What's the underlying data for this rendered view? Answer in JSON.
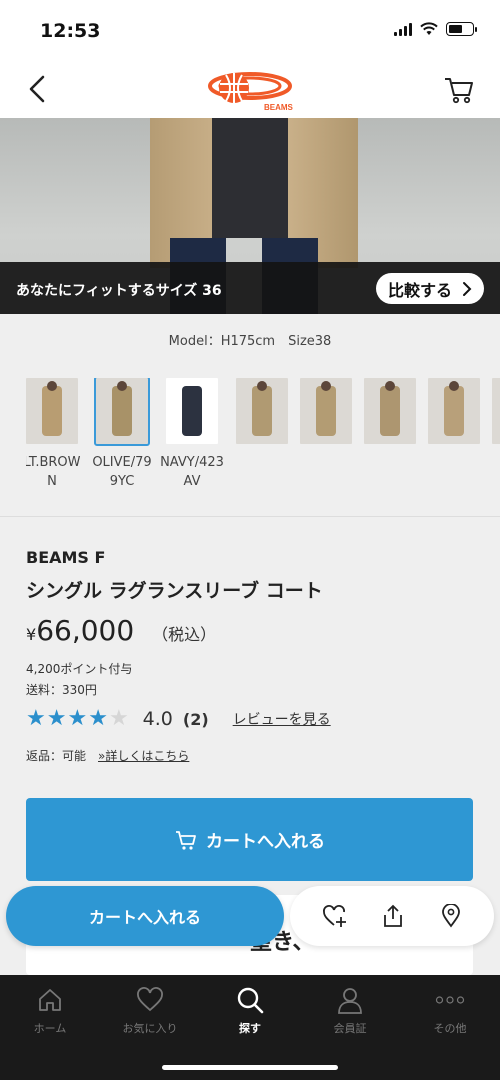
{
  "status_bar": {
    "time": "12:53"
  },
  "header": {
    "logo_text": "BEAMS"
  },
  "hero": {
    "fit_text": "あなたにフィットするサイズ 36",
    "compare_label": "比較する"
  },
  "model_info": "Model：H175cm　Size38",
  "variants": [
    {
      "label": "LT.BROWN",
      "color": "#b89d72",
      "selected": false
    },
    {
      "label": "OLIVE/799YC",
      "color": "#a89268",
      "selected": true
    },
    {
      "label": "NAVY/423AV",
      "color": "#2c3240",
      "selected": false
    },
    {
      "label": "",
      "color": "#b09a72",
      "selected": false
    },
    {
      "label": "",
      "color": "#b39c73",
      "selected": false
    },
    {
      "label": "",
      "color": "#ad9670",
      "selected": false
    },
    {
      "label": "",
      "color": "#b8a07a",
      "selected": false
    },
    {
      "label": "",
      "color": "#b49d75",
      "selected": false
    }
  ],
  "product": {
    "brand": "BEAMS F",
    "name": "シングル ラグランスリーブ コート",
    "price_yen": "¥",
    "price": "66,000",
    "tax_note": "（税込）",
    "points": "4,200ポイント付与",
    "shipping": "送料：330円",
    "rating": {
      "value": 4,
      "label": "4.0",
      "count": "(2)",
      "review_link": "レビューを見る"
    },
    "returns": "返品：可能",
    "returns_link": "»詳しくはこちら",
    "cart_button": "カートへ入れる"
  },
  "card_peek": "望き、",
  "floating_bar": {
    "cart_button": "カートへ入れる",
    "actions": [
      "favorite-add-icon",
      "share-icon",
      "location-pin-icon"
    ]
  },
  "tab_bar": {
    "tabs": [
      {
        "label": "ホーム",
        "icon": "home-icon",
        "active": false
      },
      {
        "label": "お気に入り",
        "icon": "heart-icon",
        "active": false
      },
      {
        "label": "探す",
        "icon": "search-icon",
        "active": true
      },
      {
        "label": "会員証",
        "icon": "member-icon",
        "active": false
      },
      {
        "label": "その他",
        "icon": "more-icon",
        "active": false
      }
    ]
  },
  "colors": {
    "accent": "#2e97d3",
    "star": "#2b8fcc",
    "tab_bar_bg": "#1a1a1a",
    "logo_orange": "#f05a28"
  }
}
